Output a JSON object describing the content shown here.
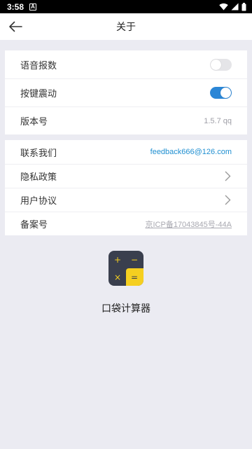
{
  "status_bar": {
    "time": "3:58",
    "notification_badge": "A"
  },
  "header": {
    "title": "关于"
  },
  "settings": [
    {
      "label": "语音报数",
      "toggle": false
    },
    {
      "label": "按键震动",
      "toggle": true
    },
    {
      "label": "版本号",
      "value": "1.5.7  qq"
    }
  ],
  "info": {
    "contact": {
      "label": "联系我们",
      "value": "feedback666@126.com"
    },
    "privacy": {
      "label": "隐私政策"
    },
    "agreement": {
      "label": "用户协议"
    },
    "filing": {
      "label": "备案号",
      "value": "京ICP备17043845号-44A"
    }
  },
  "app": {
    "name": "口袋计算器",
    "icon_glyphs": {
      "plus": "+",
      "minus": "−",
      "times": "×",
      "equals": "="
    }
  },
  "colors": {
    "accent": "#2b86d6",
    "link": "#1f8fd1",
    "background": "#ebebf2",
    "icon_dark": "#3a3f4e",
    "icon_yellow": "#f5cf20"
  }
}
